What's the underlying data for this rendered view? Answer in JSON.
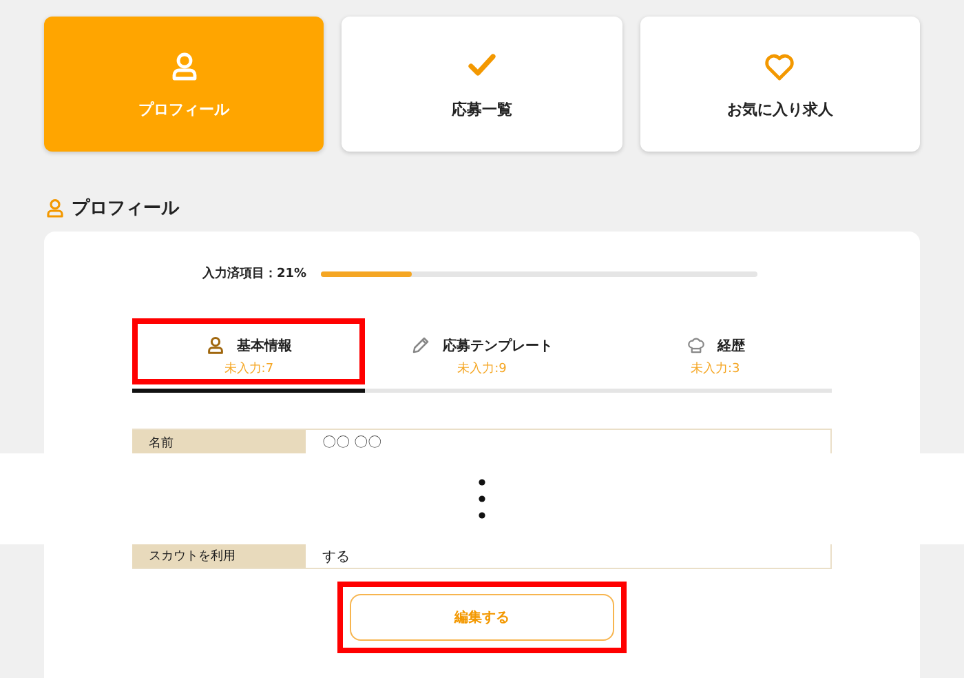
{
  "nav_cards": [
    {
      "label": "プロフィール",
      "selected": true
    },
    {
      "label": "応募一覧",
      "selected": false
    },
    {
      "label": "お気に入り求人",
      "selected": false
    }
  ],
  "section": {
    "title": "プロフィール"
  },
  "progress": {
    "label": "入力済項目：21%",
    "level": 0.21
  },
  "tabs": [
    {
      "label": "基本情報",
      "sub": "未入力:7",
      "selected": true,
      "highlighted": true
    },
    {
      "label": "応募テンプレート",
      "sub": "未入力:9",
      "selected": false,
      "highlighted": false
    },
    {
      "label": "経歴",
      "sub": "未入力:3",
      "selected": false,
      "highlighted": false
    }
  ],
  "rows": [
    {
      "label": "名前",
      "value": "〇〇 〇〇"
    },
    {
      "label": "スカウトを利用",
      "value": "する"
    }
  ],
  "edit_button": {
    "label": "編集する",
    "highlighted": true
  }
}
